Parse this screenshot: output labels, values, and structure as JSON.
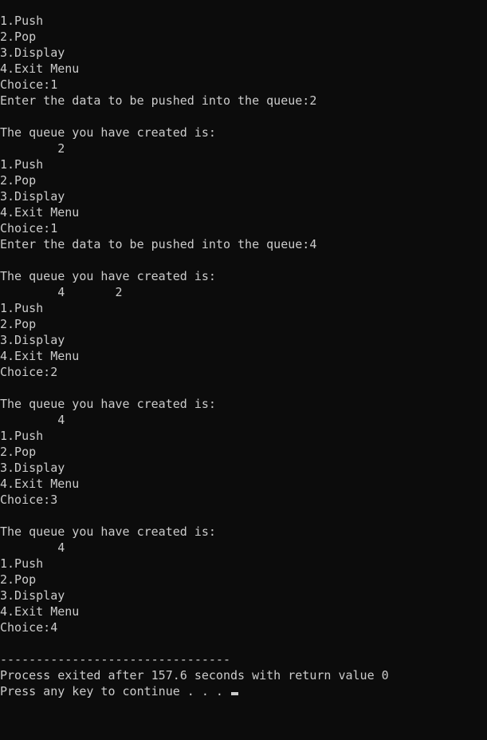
{
  "console": {
    "lines": [
      "1.Push",
      "2.Pop",
      "3.Display",
      "4.Exit Menu",
      "Choice:1",
      "Enter the data to be pushed into the queue:2",
      "",
      "The queue you have created is:",
      "\t2",
      "1.Push",
      "2.Pop",
      "3.Display",
      "4.Exit Menu",
      "Choice:1",
      "Enter the data to be pushed into the queue:4",
      "",
      "The queue you have created is:",
      "\t4\t2",
      "1.Push",
      "2.Pop",
      "3.Display",
      "4.Exit Menu",
      "Choice:2",
      "",
      "The queue you have created is:",
      "\t4",
      "1.Push",
      "2.Pop",
      "3.Display",
      "4.Exit Menu",
      "Choice:3",
      "",
      "The queue you have created is:",
      "\t4",
      "1.Push",
      "2.Pop",
      "3.Display",
      "4.Exit Menu",
      "Choice:4",
      "",
      "--------------------------------",
      "Process exited after 157.6 seconds with return value 0",
      "Press any key to continue . . . "
    ],
    "text_color": "#cccccc",
    "background_color": "#0c0c0c"
  }
}
